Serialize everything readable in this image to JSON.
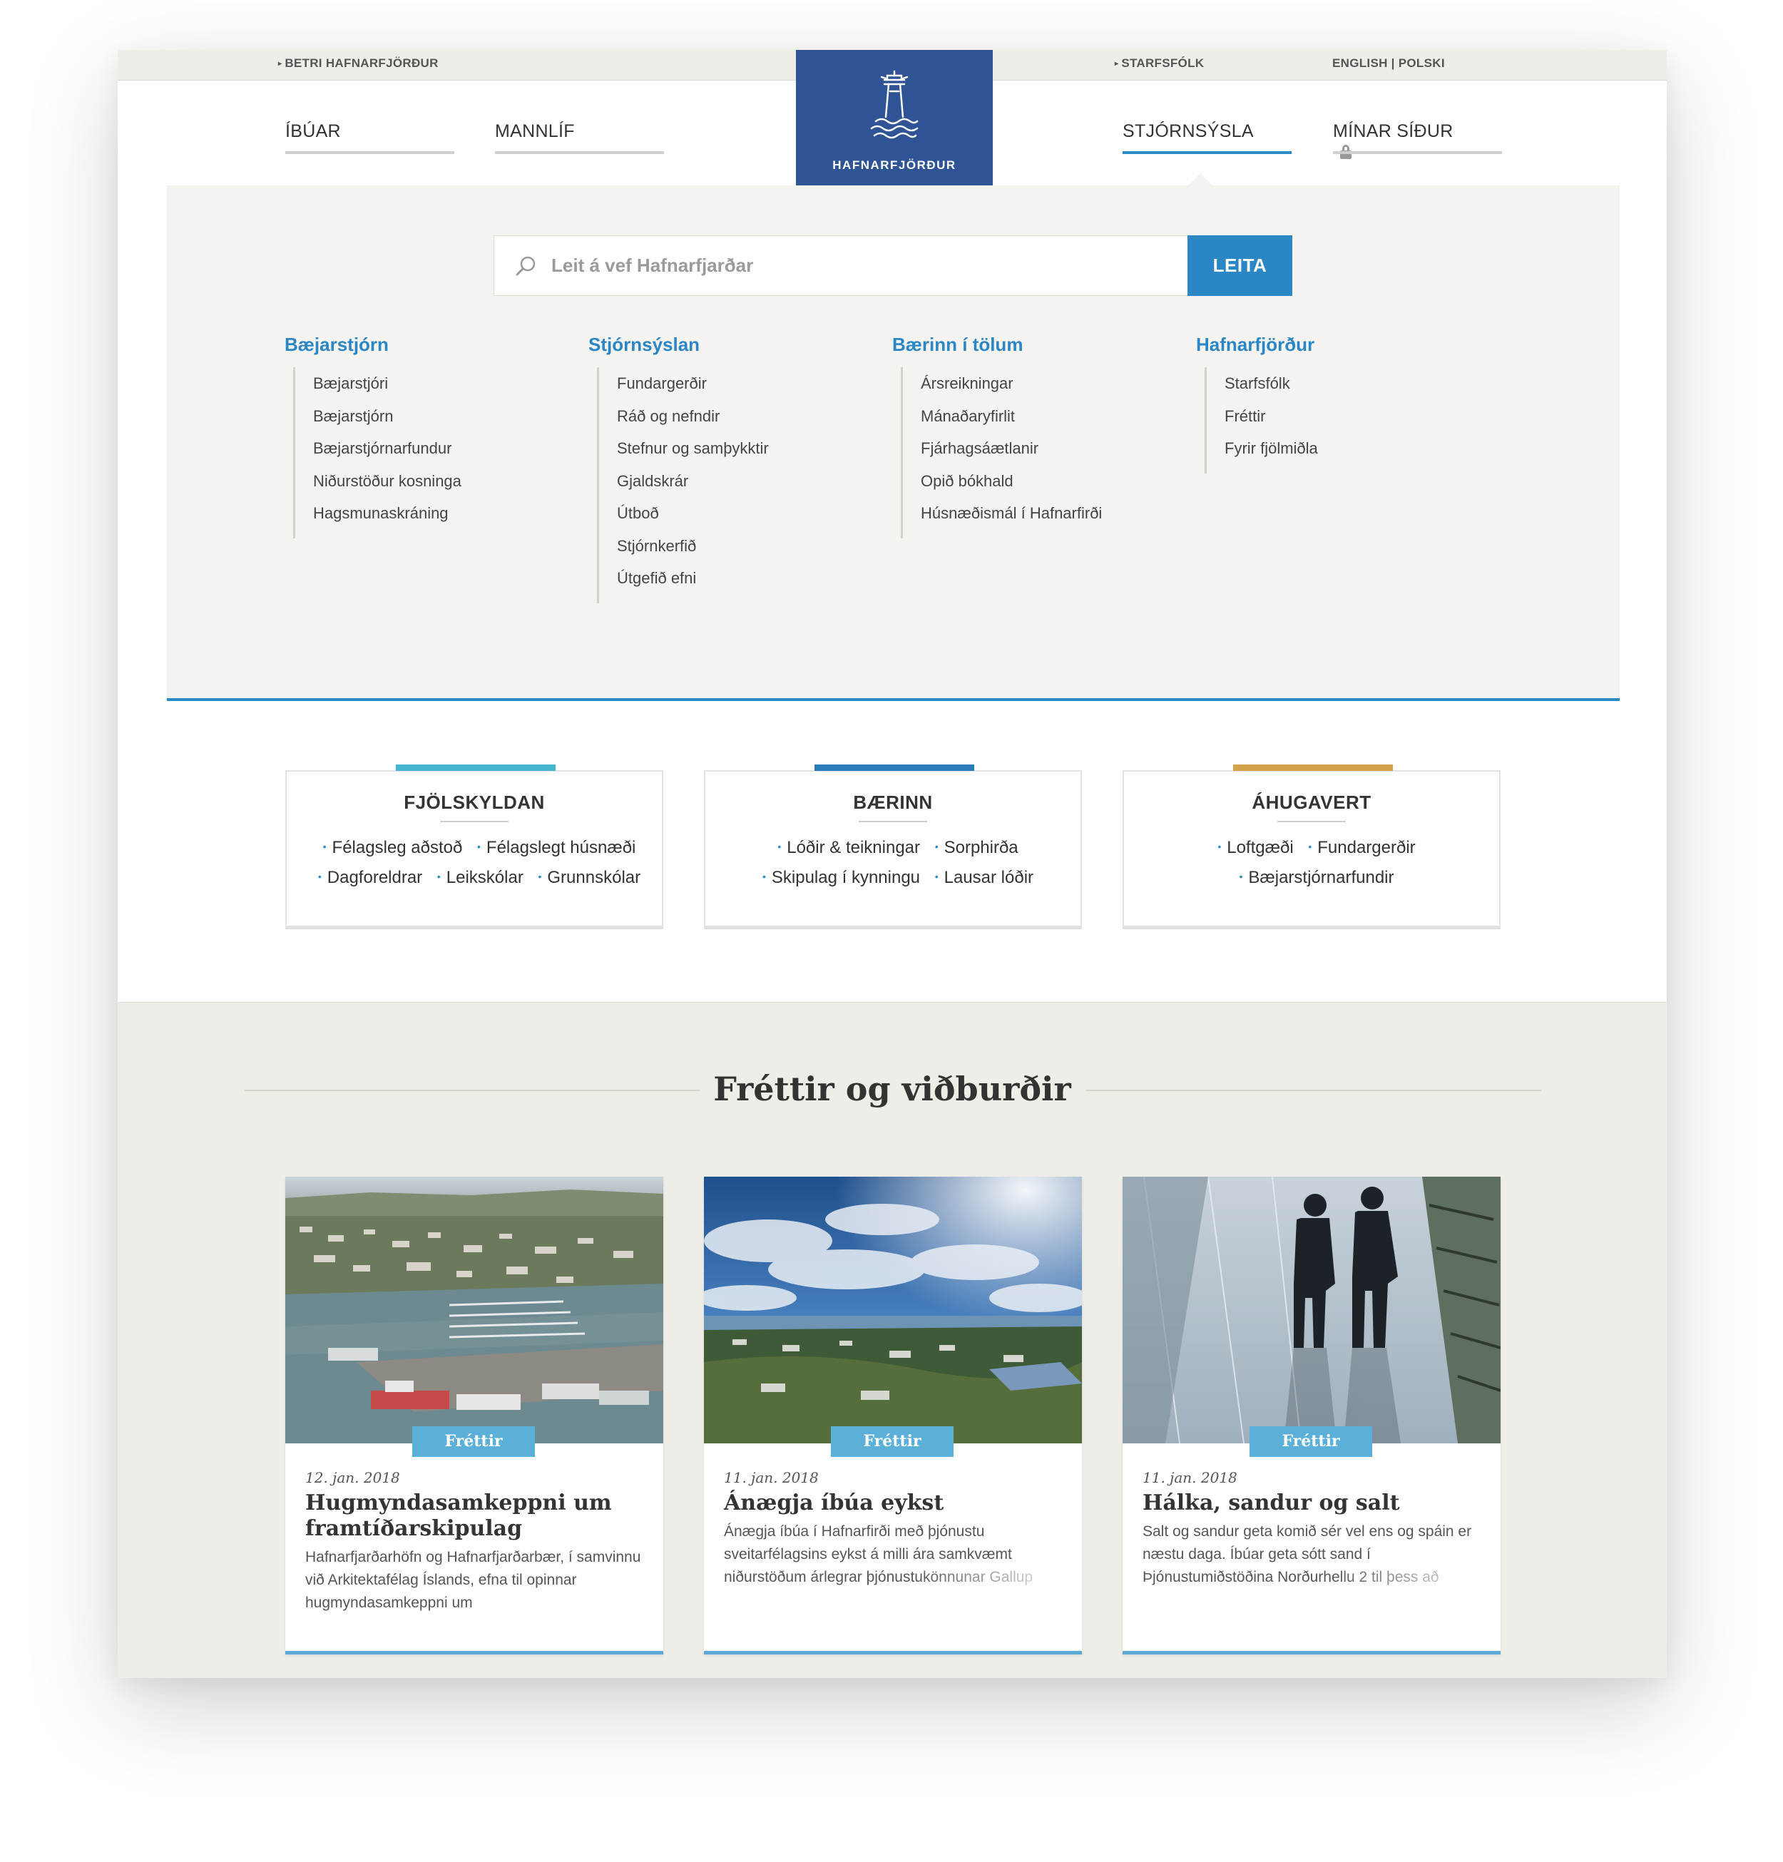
{
  "util": {
    "left_link": "BETRI HAFNARFJÖRÐUR",
    "right_link": "STARFSFÓLK",
    "languages": "ENGLISH | POLSKI"
  },
  "nav": {
    "items": [
      "ÍBÚAR",
      "MANNLÍF",
      "STJÓRNSÝSLA",
      "MÍNAR SÍÐUR"
    ],
    "active": "STJÓRNSÝSLA"
  },
  "logo": {
    "text": "HAFNARFJÖRÐUR"
  },
  "search": {
    "placeholder": "Leit á vef Hafnarfjarðar",
    "button": "LEITA"
  },
  "menu": {
    "columns": [
      {
        "title": "Bæjarstjórn",
        "links": [
          "Bæjarstjóri",
          "Bæjarstjórn",
          "Bæjarstjórnarfundur",
          "Niðurstöður kosninga",
          "Hagsmunaskráning"
        ]
      },
      {
        "title": "Stjórnsýslan",
        "links": [
          "Fundargerðir",
          "Ráð og nefndir",
          "Stefnur og samþykktir",
          "Gjaldskrár",
          "Útboð",
          "Stjórnkerfið",
          "Útgefið efni"
        ]
      },
      {
        "title": "Bærinn í tölum",
        "links": [
          "Ársreikningar",
          "Mánaðaryfirlit",
          "Fjárhagsáætlanir",
          "Opið bókhald",
          "Húsnæðismál í Hafnarfirði"
        ]
      },
      {
        "title": "Hafnarfjörður",
        "links": [
          "Starfsfólk",
          "Fréttir",
          "Fyrir fjölmiðla"
        ]
      }
    ]
  },
  "quick": [
    {
      "title": "FJÖLSKYLDAN",
      "color": "#45b6cf",
      "rows": [
        [
          "Félagsleg aðstoð",
          "Félagslegt húsnæði"
        ],
        [
          "Dagforeldrar",
          "Leikskólar",
          "Grunnskólar"
        ]
      ]
    },
    {
      "title": "BÆRINN",
      "color": "#2a7ab8",
      "rows": [
        [
          "Lóðir & teikningar",
          "Sorphirða"
        ],
        [
          "Skipulag í kynningu",
          "Lausar lóðir"
        ]
      ]
    },
    {
      "title": "ÁHUGAVERT",
      "color": "#d4a24a",
      "rows": [
        [
          "Loftgæði",
          "Fundargerðir"
        ],
        [
          "Bæjarstjórnarfundir"
        ]
      ]
    }
  ],
  "news": {
    "title": "Fréttir og viðburðir",
    "items": [
      {
        "tag": "Fréttir",
        "date": "12. jan. 2018",
        "headline": "Hugmyndasamkeppni um framtíðarskipulag",
        "text": "Hafnarfjarðarhöfn og Hafnarfjarðarbær, í samvinnu við Arkitektafélag Íslands, efna til opinnar hugmyndasamkeppni um"
      },
      {
        "tag": "Fréttir",
        "date": "11. jan. 2018",
        "headline": "Ánægja íbúa eykst",
        "text": "Ánægja íbúa í Hafnarfirði með þjónustu sveitarfélagsins eykst á milli ára samkvæmt niðurstöðum árlegrar þjónustukönnunar Gallup"
      },
      {
        "tag": "Fréttir",
        "date": "11. jan. 2018",
        "headline": "Hálka, sandur og salt",
        "text": "Salt og sandur geta komið sér vel ens og spáin er næstu daga. Íbúar geta sótt sand í Þjónustumiðstöðina Norðurhellu 2 til þess að"
      }
    ]
  }
}
